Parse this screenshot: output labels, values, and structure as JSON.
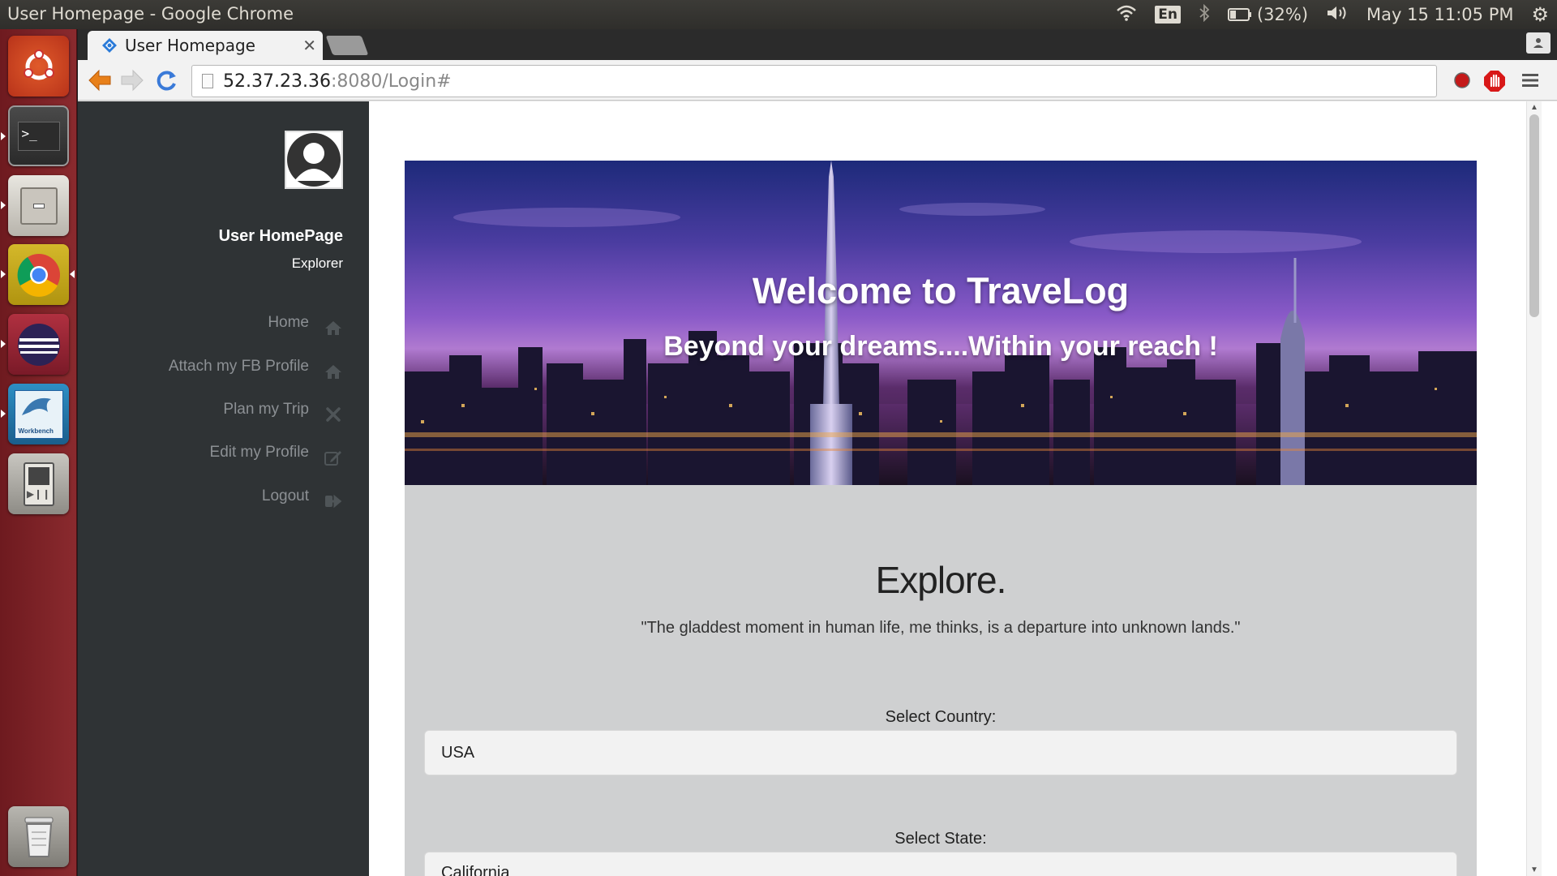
{
  "system_panel": {
    "window_title": "User Homepage - Google Chrome",
    "keyboard_layout": "En",
    "battery": "(32%)",
    "clock": "May 15 11:05 PM",
    "icons": [
      "wifi-icon",
      "bluetooth-icon",
      "battery-icon",
      "volume-icon",
      "settings-gear-icon"
    ]
  },
  "launcher": {
    "items": [
      "ubuntu-dash",
      "terminal",
      "file-manager",
      "chrome",
      "eclipse",
      "mysql-workbench",
      "media-player",
      "trash"
    ],
    "workbench_text": "Workbench"
  },
  "browser": {
    "tab_title": "User Homepage",
    "url_host": "52.37.23.36",
    "url_path": ":8080/Login#"
  },
  "sidebar": {
    "user_name": "User HomePage",
    "user_role": "Explorer",
    "nav": [
      {
        "label": "Home",
        "icon": "home-icon"
      },
      {
        "label": "Attach my FB Profile",
        "icon": "home-icon"
      },
      {
        "label": "Plan my Trip",
        "icon": "tools-icon"
      },
      {
        "label": "Edit my Profile",
        "icon": "edit-icon"
      },
      {
        "label": "Logout",
        "icon": "logout-icon"
      }
    ]
  },
  "hero": {
    "title": "Welcome to TraveLog",
    "subtitle": "Beyond your dreams....Within your reach !"
  },
  "explore": {
    "title": "Explore.",
    "quote": "\"The gladdest moment in human life, me thinks, is a departure into unknown lands.\"",
    "country_label": "Select Country:",
    "country_value": "USA",
    "state_label": "Select State:",
    "state_value": "California"
  }
}
